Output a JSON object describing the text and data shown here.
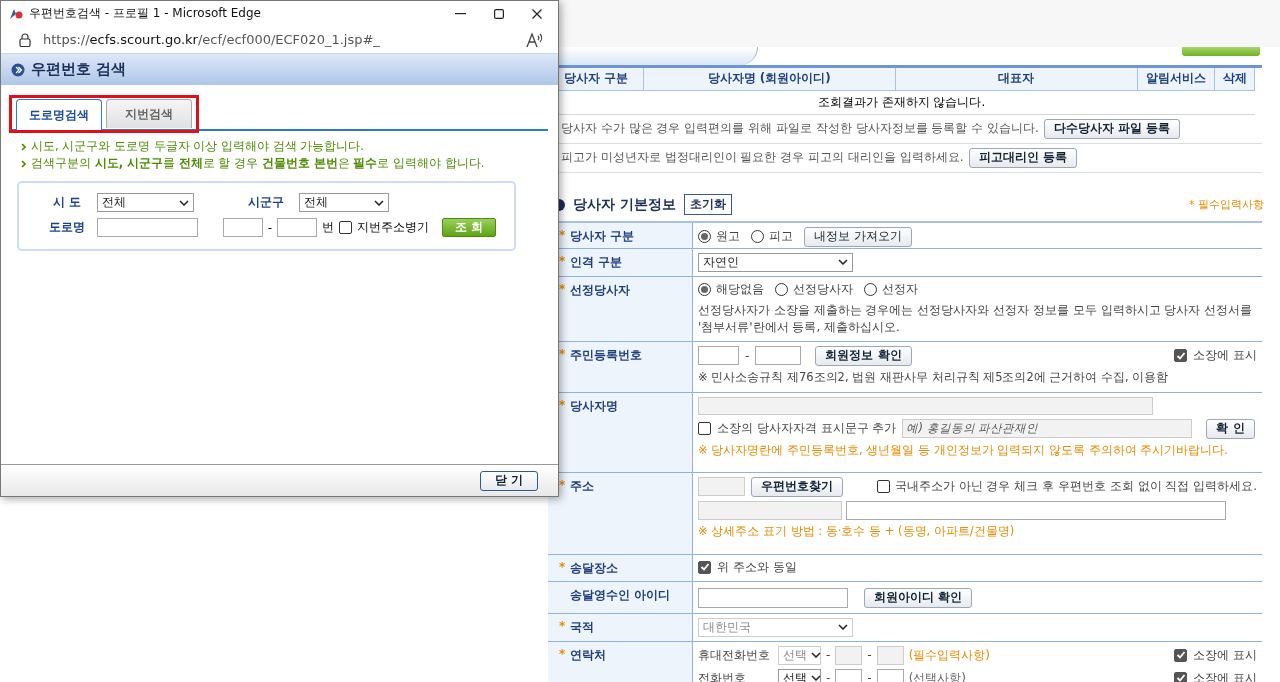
{
  "popup": {
    "title": "우편번호검색 - 프로필 1 - Microsoft Edge",
    "url": "https://ecfs.scourt.go.kr/ecf/ecf000/ECF020_1.jsp#_",
    "heading": "우편번호 검색",
    "tabs": [
      {
        "label": "도로명검색",
        "selected": true
      },
      {
        "label": "지번검색",
        "selected": false
      }
    ],
    "tabs_highlighted": true,
    "notes": [
      "시도, 시군구와 도로명 두글자 이상 입력해야 검색 가능합니다.",
      "검색구분의 **시도, 시군구**를 **전체**로 할 경우 **건물번호 본번**은 **필수**로 입력해야 합니다."
    ],
    "search": {
      "sido_label": "시 도",
      "sido_value": "전체",
      "sigungu_label": "시군구",
      "sigungu_value": "전체",
      "road_label": "도로명",
      "dash": "-",
      "unit": "번",
      "jibun_checkbox": {
        "label": "지번주소병기",
        "checked": false
      },
      "search_button": "조 회"
    },
    "close_button": "닫 기"
  },
  "party_list": {
    "columns": [
      "당사자 구분",
      "당사자명 (회원아이디)",
      "대표자",
      "알림서비스",
      "삭제"
    ],
    "empty_message": "조회결과가 존재하지 않습니다.",
    "notes": [
      {
        "text": "당사자 수가 많은 경우 입력편의를 위해 파일로 작성한 당사자정보를 등록할 수 있습니다.",
        "button": "다수당사자 파일 등록"
      },
      {
        "text": "피고가 미성년자로 법정대리인이 필요한 경우 피고의 대리인을 입력하세요.",
        "button": "피고대리인 등록"
      }
    ]
  },
  "basic_info": {
    "title": "당사자 기본정보",
    "reset_button": "초기화",
    "required_note": "* 필수입력사항",
    "rows": [
      {
        "kind": "radios",
        "marker": "*",
        "label": "당사자 구분",
        "options": [
          {
            "label": "원고",
            "selected": true
          },
          {
            "label": "피고",
            "selected": false
          }
        ],
        "button": "내정보 가져오기"
      },
      {
        "kind": "select",
        "marker": "*",
        "label": "인격 구분",
        "value": "자연인",
        "disabled": false
      },
      {
        "kind": "radios",
        "marker": "*",
        "label": "선정당사자",
        "options": [
          {
            "label": "해당없음",
            "selected": true
          },
          {
            "label": "선정당사자",
            "selected": false
          },
          {
            "label": "선정자",
            "selected": false
          }
        ],
        "help": "선정당사자가 소장을 제출하는 경우에는 선정당사자와 선정자 정보를 모두 입력하시고 당사자 선정서를 '첨부서류'란에서 등록, 제출하십시오."
      },
      {
        "kind": "id_number",
        "marker": "*",
        "label": "주민등록번호",
        "dash": "-",
        "button": "회원정보 확인",
        "show_checkbox": {
          "label": "소장에 표시",
          "checked": true
        },
        "note": "※ 민사소송규칙 제76조의2, 법원 재판사무 처리규칙 제5조의2에 근거하여 수집, 이용함"
      },
      {
        "kind": "name",
        "marker": "*",
        "label": "당사자명",
        "checkbox": {
          "label": "소장의 당사자자격 표시문구 추가",
          "checked": false
        },
        "placeholder": "예) 홍길동의 파산관재인",
        "button": "확 인",
        "warning": "※ 당사자명란에 주민등록번호, 생년월일 등 개인정보가 입력되지 않도록 주의하여 주시기바랍니다."
      },
      {
        "kind": "address",
        "marker": "*",
        "label": "주소",
        "button": "우편번호찾기",
        "checkbox": {
          "label": "국내주소가 아닌 경우 체크 후 우편번호 조회 없이 직접 입력하세요.",
          "checked": false
        },
        "note": "※ 상세주소 표기 방법 : 동·호수 등 + (동명, 아파트/건물명)"
      },
      {
        "kind": "checkbox",
        "marker": "*",
        "label": "송달장소",
        "checkbox": {
          "label": "위 주소와 동일",
          "checked": true
        }
      },
      {
        "kind": "input_button",
        "label": "송달영수인 아이디",
        "button": "회원아이디 확인"
      },
      {
        "kind": "select",
        "marker": "*",
        "label": "국적",
        "value": "대한민국",
        "disabled": true
      },
      {
        "kind": "phones",
        "marker": "*",
        "label": "연락처",
        "dash": "-",
        "phones": [
          {
            "label": "휴대전화번호",
            "select": "선택",
            "disabled": true,
            "hint": "(필수입력사항)",
            "hint_required": true,
            "show_checkbox": {
              "label": "소장에 표시",
              "checked": true
            }
          },
          {
            "label": "전화번호",
            "select": "선택",
            "disabled": false,
            "hint": "(선택사항)",
            "hint_required": false,
            "show_checkbox": {
              "label": "소장에 표시",
              "checked": true
            }
          }
        ]
      }
    ]
  }
}
